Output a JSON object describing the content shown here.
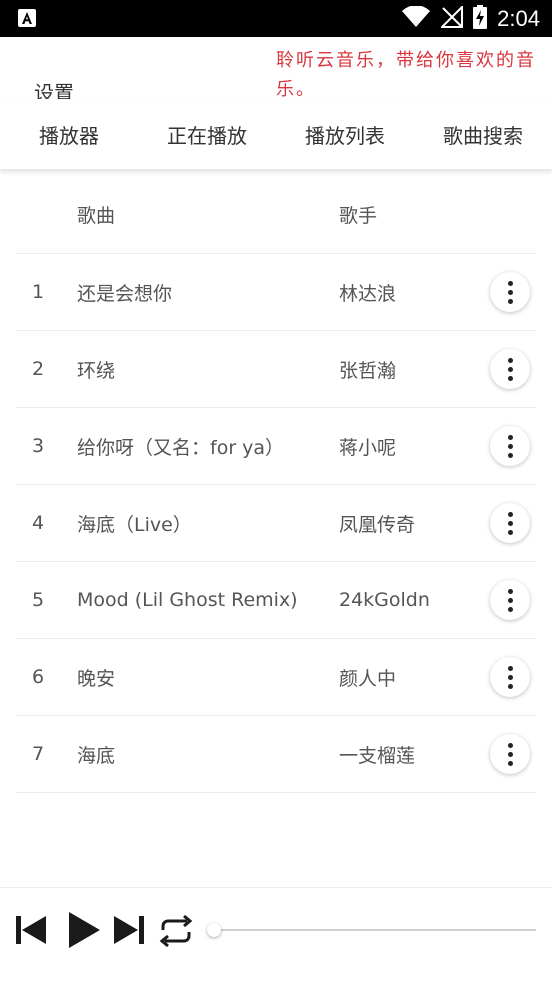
{
  "status_bar": {
    "time": "2:04",
    "icons": [
      "notification-app-icon",
      "wifi-icon",
      "no-signal-icon",
      "battery-charging-icon"
    ]
  },
  "header": {
    "settings_label": "设置",
    "banner_text": "聆听云音乐，带给你喜欢的音乐。",
    "banner_color": "#d9363e"
  },
  "tabs": [
    {
      "label": "播放器"
    },
    {
      "label": "正在播放"
    },
    {
      "label": "播放列表"
    },
    {
      "label": "歌曲搜索"
    }
  ],
  "table": {
    "headers": {
      "index": "",
      "title": "歌曲",
      "artist": "歌手"
    },
    "rows": [
      {
        "index": "1",
        "title": "还是会想你",
        "artist": "林达浪"
      },
      {
        "index": "2",
        "title": "环绕",
        "artist": "张哲瀚"
      },
      {
        "index": "3",
        "title": "给你呀（又名：for ya）",
        "artist": "蒋小呢"
      },
      {
        "index": "4",
        "title": "海底（Live）",
        "artist": "凤凰传奇"
      },
      {
        "index": "5",
        "title": "Mood (Lil Ghost Remix)",
        "artist": "24kGoldn"
      },
      {
        "index": "6",
        "title": "晚安",
        "artist": "颜人中"
      },
      {
        "index": "7",
        "title": "海底",
        "artist": "一支榴莲"
      }
    ]
  },
  "player": {
    "controls": [
      "previous-icon",
      "play-icon",
      "next-icon",
      "repeat-icon"
    ],
    "progress": 0
  }
}
